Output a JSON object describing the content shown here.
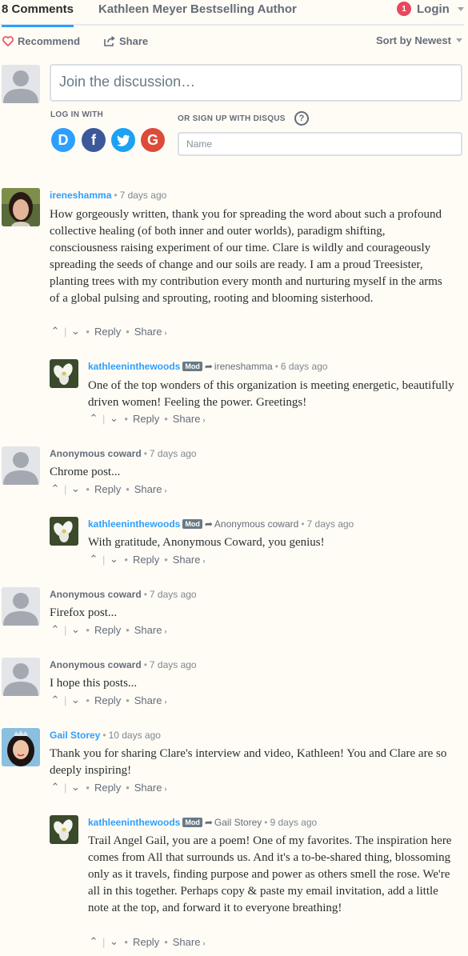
{
  "nav": {
    "comments_tab": "8 Comments",
    "community_tab": "Kathleen Meyer Bestselling Author",
    "notification_count": "1",
    "login": "Login"
  },
  "actions": {
    "recommend": "Recommend",
    "share": "Share",
    "sort": "Sort by Newest"
  },
  "composer": {
    "placeholder": "Join the discussion…",
    "login_with": "LOG IN WITH",
    "signup_with": "OR SIGN UP WITH DISQUS",
    "help": "?",
    "name_placeholder": "Name",
    "social": [
      "D",
      "f",
      "t",
      "G"
    ],
    "colors": {
      "disqus": "#2e9fff",
      "facebook": "#3b5998",
      "twitter": "#1da1f2",
      "google": "#dd4b39"
    }
  },
  "footer_labels": {
    "reply": "Reply",
    "share": "Share",
    "up": "⌃",
    "down": "⌄",
    "sep": "|",
    "dot": "•",
    "share_caret": "›",
    "mod": "Mod",
    "arrow": "➦"
  },
  "comments": [
    {
      "author": "ireneshamma",
      "time": "7 days ago",
      "text": "How gorgeously written, thank you for spreading the word about such a profound collective healing (of both inner and outer worlds), paradigm shifting, consciousness raising experiment of our time. Clare is wildly and courageously spreading the seeds of change and our soils are ready. I am a proud Treesister, planting trees with my contribution every month and nurturing myself in the arms of a global pulsing and sprouting, rooting and blooming sisterhood."
    },
    {
      "author": "kathleeninthewoods",
      "reply_to": "ireneshamma",
      "time": "6 days ago",
      "text": "One of the top wonders of this organization is meeting energetic, beautifully driven women! Feeling the power. Greetings!"
    },
    {
      "author": "Anonymous coward",
      "time": "7 days ago",
      "text": "Chrome post..."
    },
    {
      "author": "kathleeninthewoods",
      "reply_to": "Anonymous coward",
      "time": "7 days ago",
      "text": "With gratitude, Anonymous Coward, you genius!"
    },
    {
      "author": "Anonymous coward",
      "time": "7 days ago",
      "text": "Firefox post..."
    },
    {
      "author": "Anonymous coward",
      "time": "7 days ago",
      "text": "I hope this posts..."
    },
    {
      "author": "Gail Storey",
      "time": "10 days ago",
      "text": "Thank you for sharing Clare's interview and video, Kathleen! You and Clare are so deeply inspiring!"
    },
    {
      "author": "kathleeninthewoods",
      "reply_to": "Gail Storey",
      "time": "9 days ago",
      "text": "Trail Angel Gail, you are a poem! One of my favorites. The inspiration here comes from All that surrounds us. And it's a to-be-shared thing, blossoming only as it travels, finding purpose and power as others smell the rose. We're all in this together. Perhaps copy & paste my email invitation, add a little note at the top, and forward it to everyone breathing!"
    }
  ]
}
